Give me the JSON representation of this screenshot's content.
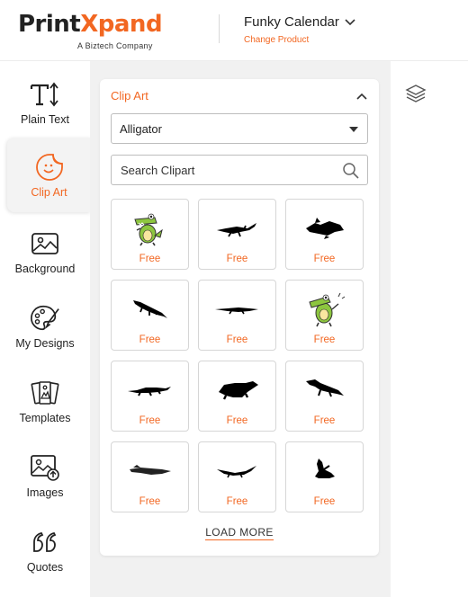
{
  "brand": {
    "logo_part1": "Print",
    "logo_part2": "Xpand",
    "tagline": "A Biztech Company"
  },
  "product": {
    "name": "Funky Calendar",
    "change_label": "Change Product"
  },
  "rail": {
    "items": [
      {
        "label": "Plain Text",
        "icon": "text-icon"
      },
      {
        "label": "Clip Art",
        "icon": "sticker-icon",
        "active": true
      },
      {
        "label": "Background",
        "icon": "image-icon"
      },
      {
        "label": "My Designs",
        "icon": "palette-icon"
      },
      {
        "label": "Templates",
        "icon": "templates-icon"
      },
      {
        "label": "Images",
        "icon": "image-upload-icon"
      },
      {
        "label": "Quotes",
        "icon": "quote-icon"
      }
    ]
  },
  "panel": {
    "title": "Clip Art",
    "category_selected": "Alligator",
    "search_placeholder": "Search Clipart",
    "load_more": "LOAD MORE",
    "items": [
      {
        "price": "Free",
        "art": "cartoon-croc-green"
      },
      {
        "price": "Free",
        "art": "silhouette-lizard-flat"
      },
      {
        "price": "Free",
        "art": "silhouette-croc-splash"
      },
      {
        "price": "Free",
        "art": "silhouette-gator-tail"
      },
      {
        "price": "Free",
        "art": "silhouette-croc-long"
      },
      {
        "price": "Free",
        "art": "cartoon-croc-green"
      },
      {
        "price": "Free",
        "art": "silhouette-croc-walk"
      },
      {
        "price": "Free",
        "art": "silhouette-croc-bulky"
      },
      {
        "price": "Free",
        "art": "silhouette-croc-raised"
      },
      {
        "price": "Free",
        "art": "silhouette-croc-swim"
      },
      {
        "price": "Free",
        "art": "silhouette-croc-thin"
      },
      {
        "price": "Free",
        "art": "silhouette-croc-head"
      }
    ]
  },
  "colors": {
    "accent": "#f26722",
    "workspace": "#f1f1f1"
  }
}
